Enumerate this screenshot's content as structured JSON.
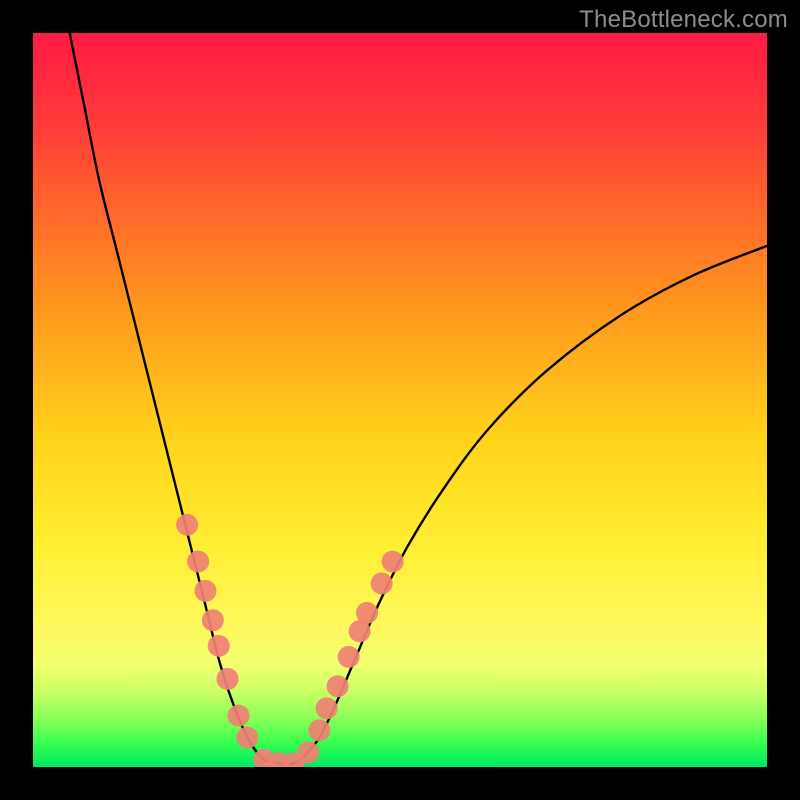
{
  "watermark": "TheBottleneck.com",
  "chart_data": {
    "type": "line",
    "title": "",
    "xlabel": "",
    "ylabel": "",
    "xlim": [
      0,
      100
    ],
    "ylim": [
      0,
      100
    ],
    "curve": {
      "name": "bottleneck-curve",
      "color": "#000000",
      "points": [
        {
          "x": 5.0,
          "y": 100.0
        },
        {
          "x": 7.0,
          "y": 90.0
        },
        {
          "x": 9.0,
          "y": 80.0
        },
        {
          "x": 11.5,
          "y": 70.0
        },
        {
          "x": 14.0,
          "y": 60.0
        },
        {
          "x": 16.5,
          "y": 50.0
        },
        {
          "x": 19.0,
          "y": 40.0
        },
        {
          "x": 21.0,
          "y": 32.0
        },
        {
          "x": 23.5,
          "y": 22.0
        },
        {
          "x": 25.5,
          "y": 14.0
        },
        {
          "x": 27.5,
          "y": 8.0
        },
        {
          "x": 29.5,
          "y": 3.5
        },
        {
          "x": 31.5,
          "y": 1.0
        },
        {
          "x": 33.5,
          "y": 0.5
        },
        {
          "x": 35.5,
          "y": 0.5
        },
        {
          "x": 37.0,
          "y": 1.5
        },
        {
          "x": 39.0,
          "y": 4.0
        },
        {
          "x": 41.0,
          "y": 8.0
        },
        {
          "x": 44.0,
          "y": 15.0
        },
        {
          "x": 47.0,
          "y": 22.0
        },
        {
          "x": 51.0,
          "y": 30.0
        },
        {
          "x": 56.0,
          "y": 38.0
        },
        {
          "x": 62.0,
          "y": 46.0
        },
        {
          "x": 70.0,
          "y": 54.0
        },
        {
          "x": 80.0,
          "y": 61.5
        },
        {
          "x": 90.0,
          "y": 67.0
        },
        {
          "x": 100.0,
          "y": 71.0
        }
      ]
    },
    "markers": {
      "name": "highlighted-points",
      "color": "#f08074",
      "radius_px": 11,
      "points": [
        {
          "x": 21.0,
          "y": 33.0
        },
        {
          "x": 22.5,
          "y": 28.0
        },
        {
          "x": 23.5,
          "y": 24.0
        },
        {
          "x": 24.5,
          "y": 20.0
        },
        {
          "x": 25.3,
          "y": 16.5
        },
        {
          "x": 26.5,
          "y": 12.0
        },
        {
          "x": 28.0,
          "y": 7.0
        },
        {
          "x": 29.2,
          "y": 4.0
        },
        {
          "x": 31.5,
          "y": 1.0
        },
        {
          "x": 33.5,
          "y": 0.5
        },
        {
          "x": 35.5,
          "y": 0.5
        },
        {
          "x": 37.5,
          "y": 2.0
        },
        {
          "x": 39.0,
          "y": 5.0
        },
        {
          "x": 40.0,
          "y": 8.0
        },
        {
          "x": 41.5,
          "y": 11.0
        },
        {
          "x": 43.0,
          "y": 15.0
        },
        {
          "x": 44.5,
          "y": 18.5
        },
        {
          "x": 45.5,
          "y": 21.0
        },
        {
          "x": 47.5,
          "y": 25.0
        },
        {
          "x": 49.0,
          "y": 28.0
        }
      ]
    },
    "gradient_bands": [
      {
        "color": "#ff1a45",
        "y_pct": 0
      },
      {
        "color": "#ff6a2a",
        "y_pct": 25
      },
      {
        "color": "#ffd21a",
        "y_pct": 55
      },
      {
        "color": "#fff85a",
        "y_pct": 80
      },
      {
        "color": "#2fff4e",
        "y_pct": 97
      },
      {
        "color": "#00e865",
        "y_pct": 100
      }
    ]
  }
}
